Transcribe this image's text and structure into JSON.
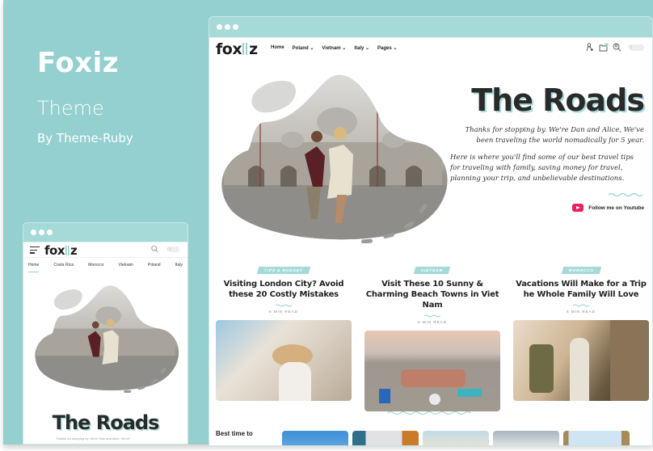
{
  "brand": {
    "title": "Foxiz",
    "subtitle": "Theme",
    "byline": "By Theme-Ruby",
    "accent": "#93d0cf"
  },
  "desktop": {
    "logo": {
      "left": "fox",
      "right": "z"
    },
    "menu": [
      {
        "label": "Home",
        "dropdown": false
      },
      {
        "label": "Poland",
        "dropdown": true
      },
      {
        "label": "Vietnam",
        "dropdown": true
      },
      {
        "label": "Italy",
        "dropdown": true
      },
      {
        "label": "Pages",
        "dropdown": true
      }
    ],
    "icons": [
      "user-icon",
      "folder-icon",
      "search-icon",
      "dark-mode-toggle"
    ],
    "hero": {
      "title": "The Roads",
      "intro": "Thanks for stopping by. We're Dan and Alice, We've been traveling the world nomadically for 5 year.",
      "body": "Here is where you'll find some of our best travel tips for traveling with family, saving money for travel, planning your trip, and unbelievable destinations.",
      "youtube_label": "Follow me on Youtube",
      "youtube_color": "#ee1d62"
    },
    "cards": [
      {
        "tag": "TIPS & BUDGET",
        "title": "Visiting London City? Avoid these 20 Costly Mistakes",
        "read": "6 MIN READ"
      },
      {
        "tag": "VIETNAM",
        "title": "Visit These 10 Sunny & Charming Beach Towns in Viet Nam",
        "read": "6 MIN READ"
      },
      {
        "tag": "MOROCCO",
        "title": "Vacations Will Make for a Trip he Whole Family Will Love",
        "read": "6 MIN READ"
      }
    ],
    "section_label": "Best time to"
  },
  "mobile": {
    "logo": {
      "left": "fox",
      "right": "z"
    },
    "menu": [
      "Home",
      "Costa Rica",
      "Morocco",
      "Vietnam",
      "Poland",
      "Italy"
    ],
    "hero_title": "The Roads",
    "hero_intro": "Thanks for stopping by. We're Dan and Alice, We've"
  }
}
